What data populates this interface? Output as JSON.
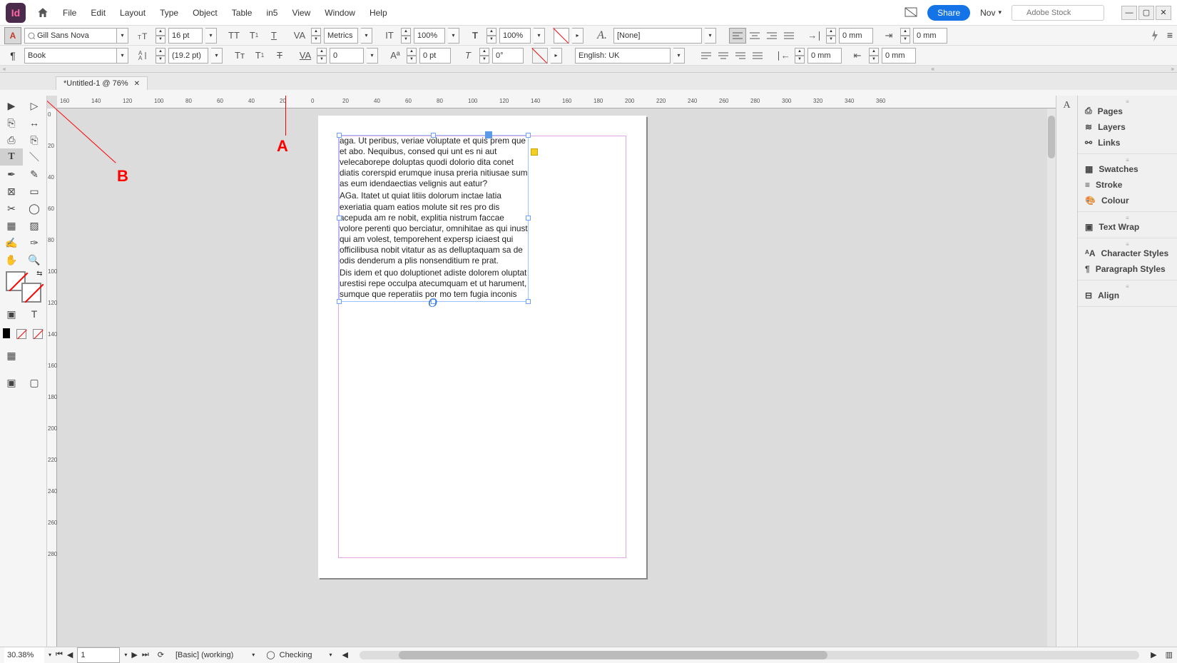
{
  "menubar": {
    "app_badge": "Id",
    "items": [
      "File",
      "Edit",
      "Layout",
      "Type",
      "Object",
      "Table",
      "in5",
      "View",
      "Window",
      "Help"
    ],
    "share": "Share",
    "workspace": "Nov",
    "stock_placeholder": "Adobe Stock"
  },
  "ctrl": {
    "font": "Gill Sans Nova",
    "style": "Book",
    "size": "16 pt",
    "leading": "(19.2 pt)",
    "kerning": "Metrics",
    "tracking": "0",
    "vscale": "100%",
    "hscale": "100%",
    "baseline": "0 pt",
    "skew": "0°",
    "para_style": "[None]",
    "lang": "English: UK",
    "indent_left": "0 mm",
    "indent_firstline": "0 mm",
    "indent_right": "0 mm",
    "indent_lastline": "0 mm",
    "space_before": "0 mm",
    "space_after": "0 mm"
  },
  "doc": {
    "tab_title": "*Untitled-1 @ 76%",
    "hruler": [
      "160",
      "140",
      "120",
      "100",
      "80",
      "60",
      "40",
      "20",
      "0",
      "20",
      "40",
      "60",
      "80",
      "100",
      "120",
      "140",
      "160",
      "180",
      "200",
      "220",
      "240",
      "260",
      "280",
      "300",
      "320",
      "340",
      "360"
    ],
    "vruler": [
      "0",
      "20",
      "40",
      "60",
      "80",
      "100",
      "120",
      "140",
      "160",
      "180",
      "200",
      "220",
      "240",
      "260",
      "280"
    ],
    "annotations": {
      "a": "A",
      "b": "B"
    },
    "para1": "aga. Ut peribus, veriae voluptate et quis prem que et abo. Nequibus, consed qui unt es ni aut velecaborepe doluptas quodi dolorio dita conet diatis corerspid erumque inusa preria nitiusae sum as eum idendaectias velignis aut eatur?",
    "para2": "AGa. Itatet ut quiat litiis dolorum inctae latia exeriatia quam eatios molute sit res pro dis acepuda am re nobit, explitia nistrum faccae volore perenti quo berciatur, omnihitae as qui inust qui am volest, temporehent expersp iciaest qui officilibusa nobit vitatur as as delluptaquam sa de odis denderum a plis nonsenditium re prat.",
    "para3": "Dis idem et quo doluptionet adiste dolorem oluptat urestisi repe occulpa atecumquam et ut harument, sumque que reperatiis por mo tem fugia inconis"
  },
  "panels": {
    "g1": [
      "Pages",
      "Layers",
      "Links"
    ],
    "g2": [
      "Swatches",
      "Stroke",
      "Colour"
    ],
    "g3": [
      "Text Wrap"
    ],
    "g4": [
      "Character Styles",
      "Paragraph Styles"
    ],
    "g5": [
      "Align"
    ]
  },
  "status": {
    "zoom": "30.38%",
    "page": "1",
    "preset": "[Basic] (working)",
    "preflight": "Checking"
  }
}
